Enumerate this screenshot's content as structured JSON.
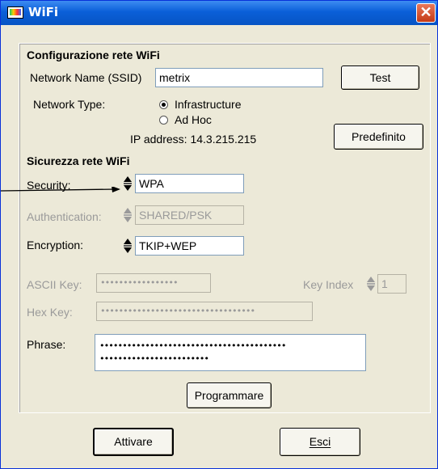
{
  "window": {
    "title": "WiFi",
    "close_glyph": "✕"
  },
  "config": {
    "header": "Configurazione rete WiFi",
    "ssid_label": "Network Name (SSID)",
    "ssid_value": "metrix",
    "test_button": "Test",
    "network_type_label": "Network Type:",
    "options": [
      "Infrastructure",
      "Ad Hoc"
    ],
    "selected": "Infrastructure",
    "ip_label": "IP address: 14.3.215.215",
    "default_button": "Predefinito"
  },
  "security": {
    "header": "Sicurezza rete WiFi",
    "security_label": "Security:",
    "security_value": "WPA",
    "auth_label": "Authentication:",
    "auth_value": "SHARED/PSK",
    "enc_label": "Encryption:",
    "enc_value": "TKIP+WEP",
    "ascii_label": "ASCII Key:",
    "ascii_value": "•••••••••••••••••",
    "key_index_label": "Key Index",
    "key_index_value": "1",
    "hex_label": "Hex Key:",
    "hex_value": "••••••••••••••••••••••••••••••••••",
    "phrase_label": "Phrase:",
    "phrase_line1": "•••••••••••••••••••••••••••••••••••••••••",
    "phrase_line2": "••••••••••••••••••••••••",
    "program_button": "Programmare"
  },
  "footer": {
    "activate_button": "Attivare",
    "exit_button": "Esci"
  }
}
